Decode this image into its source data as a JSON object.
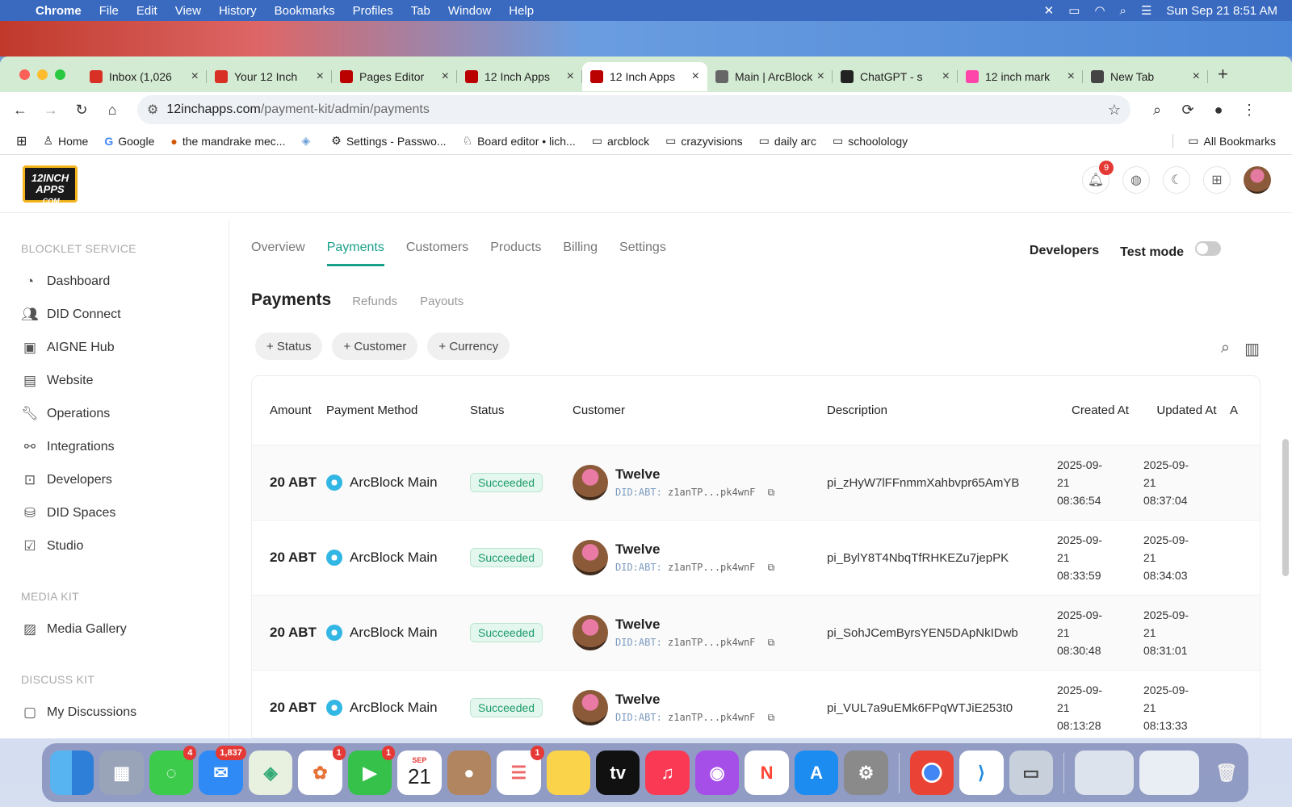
{
  "menubar": {
    "app": "Chrome",
    "items": [
      "File",
      "Edit",
      "View",
      "History",
      "Bookmarks",
      "Profiles",
      "Tab",
      "Window",
      "Help"
    ],
    "datetime": "Sun Sep 21  8:51 AM"
  },
  "tabs": [
    {
      "title": "Inbox (1,026",
      "icon": "gmail-icon",
      "color": "#d93025"
    },
    {
      "title": "Your 12 Inch",
      "icon": "gmail-icon",
      "color": "#d93025"
    },
    {
      "title": "Pages Editor",
      "icon": "12inch-icon",
      "color": "#b00"
    },
    {
      "title": "12 Inch Apps",
      "icon": "12inch-icon",
      "color": "#b00"
    },
    {
      "title": "12 Inch Apps",
      "icon": "12inch-icon",
      "color": "#b00",
      "active": true
    },
    {
      "title": "Main | ArcBlock",
      "icon": "arcblock-icon",
      "color": "#666"
    },
    {
      "title": "ChatGPT - s",
      "icon": "chatgpt-icon",
      "color": "#222"
    },
    {
      "title": "12 inch mark",
      "icon": "chart-icon",
      "color": "#f4a"
    },
    {
      "title": "New Tab",
      "icon": "chrome-icon",
      "color": "#444"
    }
  ],
  "url": {
    "host": "12inchapps.com",
    "path": "/payment-kit/admin/payments"
  },
  "bookmarks": [
    "Home",
    "Google",
    "the mandrake mec...",
    "",
    "Settings - Passwo...",
    "Board editor • lich...",
    "arcblock",
    "crazyvisions",
    "daily arc",
    "schoolology"
  ],
  "bookmarks_all": "All Bookmarks",
  "logo": {
    "line1": "12INCH",
    "line2": "APPS",
    "line3": ".COM"
  },
  "notifications": "9",
  "sidebar": {
    "sec1": "BLOCKLET SERVICE",
    "items1": [
      "Dashboard",
      "DID Connect",
      "AIGNE Hub",
      "Website",
      "Operations",
      "Integrations",
      "Developers",
      "DID Spaces",
      "Studio"
    ],
    "sec2": "MEDIA KIT",
    "items2": [
      "Media Gallery"
    ],
    "sec3": "DISCUSS KIT",
    "items3": [
      "My Discussions"
    ]
  },
  "ptabs": [
    "Overview",
    "Payments",
    "Customers",
    "Products",
    "Billing",
    "Settings"
  ],
  "developers": "Developers",
  "testmode": "Test mode",
  "subtabs": {
    "title": "Payments",
    "refunds": "Refunds",
    "payouts": "Payouts"
  },
  "filters": [
    "+ Status",
    "+ Customer",
    "+ Currency"
  ],
  "table": {
    "headers": {
      "amount": "Amount",
      "method": "Payment Method",
      "status": "Status",
      "customer": "Customer",
      "description": "Description",
      "created": "Created At",
      "updated": "Updated At",
      "a": "A"
    },
    "rows": [
      {
        "amount": "20 ABT",
        "method": "ArcBlock Main",
        "status": "Succeeded",
        "name": "Twelve",
        "did_prefix": "DID:ABT:",
        "did": "z1anTP...pk4wnF",
        "desc": "pi_zHyW7lFFnmmXahbvpr65AmYB",
        "c1": "2025-09-",
        "c2": "21",
        "c3": "08:36:54",
        "u1": "2025-09-",
        "u2": "21",
        "u3": "08:37:04"
      },
      {
        "amount": "20 ABT",
        "method": "ArcBlock Main",
        "status": "Succeeded",
        "name": "Twelve",
        "did_prefix": "DID:ABT:",
        "did": "z1anTP...pk4wnF",
        "desc": "pi_BylY8T4NbqTfRHKEZu7jepPK",
        "c1": "2025-09-",
        "c2": "21",
        "c3": "08:33:59",
        "u1": "2025-09-",
        "u2": "21",
        "u3": "08:34:03"
      },
      {
        "amount": "20 ABT",
        "method": "ArcBlock Main",
        "status": "Succeeded",
        "name": "Twelve",
        "did_prefix": "DID:ABT:",
        "did": "z1anTP...pk4wnF",
        "desc": "pi_SohJCemByrsYEN5DApNkIDwb",
        "c1": "2025-09-",
        "c2": "21",
        "c3": "08:30:48",
        "u1": "2025-09-",
        "u2": "21",
        "u3": "08:31:01"
      },
      {
        "amount": "20 ABT",
        "method": "ArcBlock Main",
        "status": "Succeeded",
        "name": "Twelve",
        "did_prefix": "DID:ABT:",
        "did": "z1anTP...pk4wnF",
        "desc": "pi_VUL7a9uEMk6FPqWTJiE253t0",
        "c1": "2025-09-",
        "c2": "21",
        "c3": "08:13:28",
        "u1": "2025-09-",
        "u2": "21",
        "u3": "08:13:33"
      }
    ]
  },
  "dock": {
    "messages_badge": "4",
    "mail_badge": "1,837",
    "photos_badge": "1",
    "facetime_badge": "1",
    "reminders_badge": "1",
    "cal_month": "SEP",
    "cal_day": "21"
  }
}
